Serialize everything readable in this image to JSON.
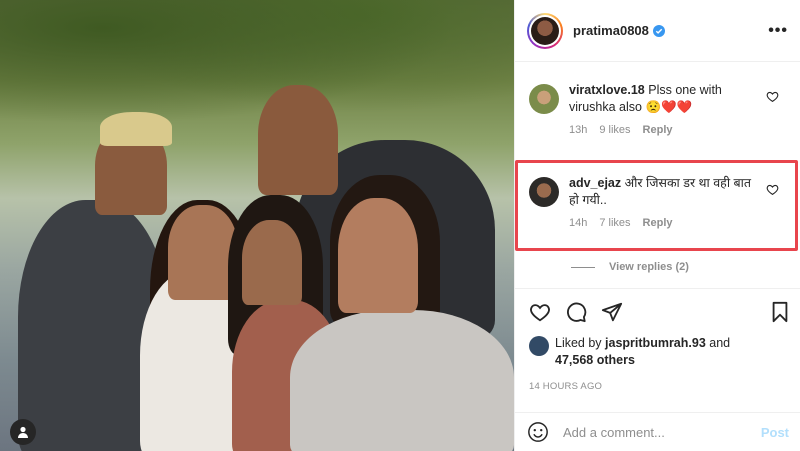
{
  "post": {
    "username": "pratima0808",
    "verified": true,
    "more_icon": "more-dots-icon"
  },
  "comments": [
    {
      "username": "viratxlove.18",
      "text": "Plss one with virushka also",
      "emojis": "😟❤️❤️",
      "time": "13h",
      "likes": "9 likes",
      "reply": "Reply"
    },
    {
      "username": "adv_ejaz",
      "text": "और जिसका डर था वही बात हो गयी..",
      "time": "14h",
      "likes": "7 likes",
      "reply": "Reply",
      "highlighted": true
    }
  ],
  "view_replies": "View replies (2)",
  "actions": {
    "icons": [
      "heart-icon",
      "comment-icon",
      "share-icon",
      "save-icon"
    ]
  },
  "likes": {
    "prefix": "Liked by",
    "user": "jaspritbumrah.93",
    "joiner": "and",
    "others": "47,568 others"
  },
  "timestamp": "14 HOURS AGO",
  "add_comment": {
    "placeholder": "Add a comment...",
    "post_label": "Post"
  },
  "colors": {
    "highlight": "#e8454d",
    "verified": "#3897f0",
    "heart_red": "#ed4956",
    "post_disabled": "#b2dffc"
  }
}
